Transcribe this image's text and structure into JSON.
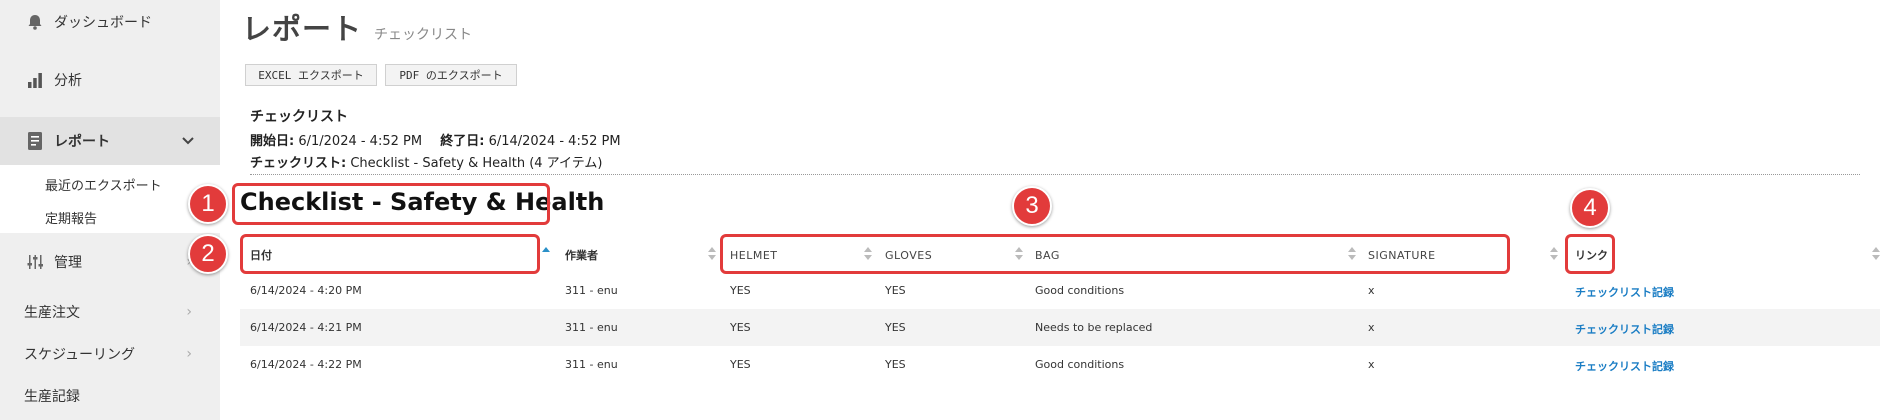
{
  "sidebar": {
    "dashboard": "ダッシュボード",
    "analysis": "分析",
    "reports": "レポート",
    "reports_sub": [
      "最近のエクスポート",
      "定期報告"
    ],
    "admin": "管理",
    "production_orders": "生産注文",
    "scheduling": "スケジューリング",
    "production_records": "生産記録"
  },
  "header": {
    "title": "レポート",
    "subtitle": "チェックリスト"
  },
  "toolbar": {
    "excel_export": "EXCEL エクスポート",
    "pdf_export": "PDF のエクスポート"
  },
  "info": {
    "heading": "チェックリスト",
    "start_label": "開始日:",
    "start_value": "6/1/2024 - 4:52 PM",
    "end_label": "終了日:",
    "end_value": "6/14/2024 - 4:52 PM",
    "checklist_label": "チェックリスト:",
    "checklist_value": "Checklist - Safety & Health (4 アイテム)"
  },
  "checklist_title": "Checklist - Safety & Health",
  "table": {
    "columns": [
      "日付",
      "作業者",
      "HELMET",
      "GLOVES",
      "BAG",
      "SIGNATURE",
      "リンク"
    ],
    "rows": [
      [
        "6/14/2024 - 4:20 PM",
        "311 - enu",
        "YES",
        "YES",
        "Good conditions",
        "x",
        "チェックリスト記録"
      ],
      [
        "6/14/2024 - 4:21 PM",
        "311 - enu",
        "YES",
        "YES",
        "Needs to be replaced",
        "x",
        "チェックリスト記録"
      ],
      [
        "6/14/2024 - 4:22 PM",
        "311 - enu",
        "YES",
        "YES",
        "Good conditions",
        "x",
        "チェックリスト記録"
      ]
    ]
  },
  "annotations": [
    "1",
    "2",
    "3",
    "4"
  ],
  "colors": {
    "annotation": "#e23b3b",
    "link": "#1a7dc4",
    "sort_active": "#2a90c8",
    "sidebar_bg": "#efefef"
  },
  "icons": {
    "dashboard": "bell-icon",
    "analysis": "bar-chart-icon",
    "reports": "report-document-icon",
    "admin": "sliders-icon"
  }
}
